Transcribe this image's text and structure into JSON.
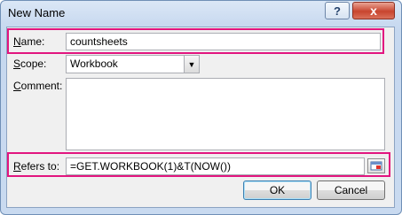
{
  "window": {
    "title": "New Name",
    "help_glyph": "?",
    "close_glyph": "x"
  },
  "name": {
    "label_accel": "N",
    "label_rest": "ame:",
    "value": "countsheets"
  },
  "scope": {
    "label_accel": "S",
    "label_rest": "cope:",
    "value": "Workbook",
    "arrow": "▼"
  },
  "comment": {
    "label_accel": "C",
    "label_rest": "omment:",
    "value": ""
  },
  "refers": {
    "label_accel": "R",
    "label_rest": "efers to:",
    "value": "=GET.WORKBOOK(1)&T(NOW())"
  },
  "buttons": {
    "ok": "OK",
    "cancel": "Cancel"
  },
  "colors": {
    "highlight": "#e2157f",
    "title_bar": "#c9daf0",
    "dialog_bg": "#f0f0f0"
  },
  "icons": {
    "refers_button": "collapse-dialog-icon"
  }
}
